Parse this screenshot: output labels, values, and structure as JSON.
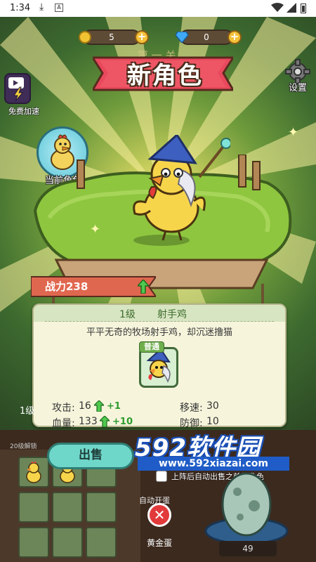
{
  "status_bar": {
    "time": "1:34",
    "download_icon": "download-icon",
    "app_icon_text": "A"
  },
  "top_bar": {
    "coins": "5",
    "gems": "0"
  },
  "header": {
    "ribbon_title": "新角色",
    "behind_text": "第 一 关",
    "settings_label": "设置"
  },
  "left_panel": {
    "speed_label": "免费加速",
    "current_role_label": "当前角色"
  },
  "character": {
    "power_label": "战力238",
    "level": "1级",
    "name": "射手鸡",
    "description": "平平无奇的牧场射手鸡，却沉迷撸猫",
    "rarity": "普通"
  },
  "stats": {
    "attack_label": "攻击:",
    "attack_value": "16",
    "attack_bonus": "+1",
    "hp_label": "血量:",
    "hp_value": "133",
    "hp_bonus": "+10",
    "speed_label": "移速:",
    "speed_value": "30",
    "defense_label": "防御:",
    "defense_value": "10"
  },
  "bottom": {
    "sell_button": "出售",
    "unlock_label": "20级解锁",
    "side_level": "1级",
    "auto_sell_text": "上阵后自动出售之前的角色",
    "auto_open_label": "自动开蛋",
    "gold_egg_label": "黄金蛋",
    "egg_count": "49"
  },
  "watermark": {
    "big": "592软件园",
    "small": "www.592xiazai.com"
  },
  "colors": {
    "ribbon": "#e9485d",
    "power_banner": "#e0674f",
    "sell_button": "#6fd7c9",
    "card": "#f6f5dc",
    "accent_green": "#2e9b2e"
  }
}
